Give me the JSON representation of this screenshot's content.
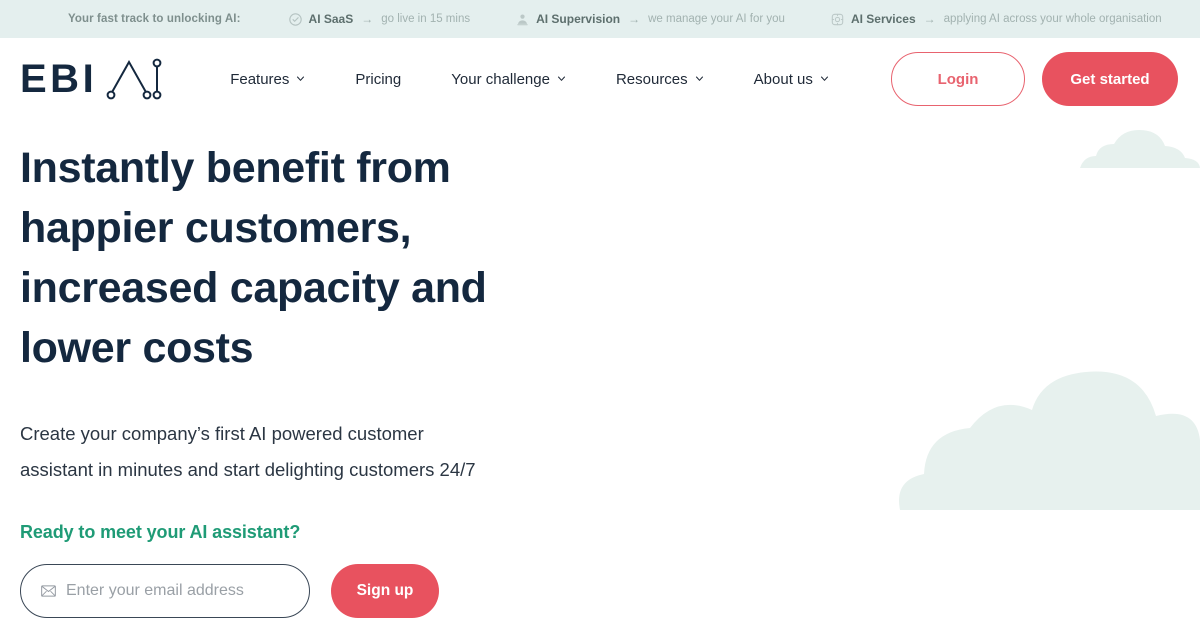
{
  "brand": {
    "name": "EBI",
    "logo_mark": "ai-network-logo-icon",
    "accent_red": "#e8525f",
    "accent_green": "#1f9b76",
    "navy": "#14283f",
    "bar_bg": "#e4efee",
    "cloud": "#e7f1ee"
  },
  "announcement": {
    "lead": "Your fast track to unlocking AI:",
    "items": [
      {
        "icon": "check-circle-icon",
        "title": "AI SaaS",
        "arrow": "→",
        "tail": "go live in 15 mins"
      },
      {
        "icon": "supervisor-person-icon",
        "title": "AI Supervision",
        "arrow": "→",
        "tail": "we manage your AI for you"
      },
      {
        "icon": "gear-settings-icon",
        "title": "AI Services",
        "arrow": "→",
        "tail": "applying AI across your whole organisation"
      }
    ]
  },
  "nav": {
    "items": [
      {
        "label": "Features",
        "has_caret": true
      },
      {
        "label": "Pricing",
        "has_caret": false
      },
      {
        "label": "Your challenge",
        "has_caret": true
      },
      {
        "label": "Resources",
        "has_caret": true
      },
      {
        "label": "About us",
        "has_caret": true
      }
    ],
    "login_label": "Login",
    "get_started_label": "Get started"
  },
  "hero": {
    "title_lines": [
      "Instantly benefit from",
      "happier customers,",
      "increased capacity and",
      "lower costs"
    ],
    "title_full": "Instantly benefit from happier customers, increased capacity and lower costs",
    "subtitle": "Create your company’s first AI powered customer assistant in minutes and start delighting customers 24/7",
    "cta_heading": "Ready to meet your AI assistant?"
  },
  "signup": {
    "email_placeholder": "Enter your email address",
    "email_value": "",
    "email_icon": "envelope-icon",
    "submit_label": "Sign up"
  }
}
